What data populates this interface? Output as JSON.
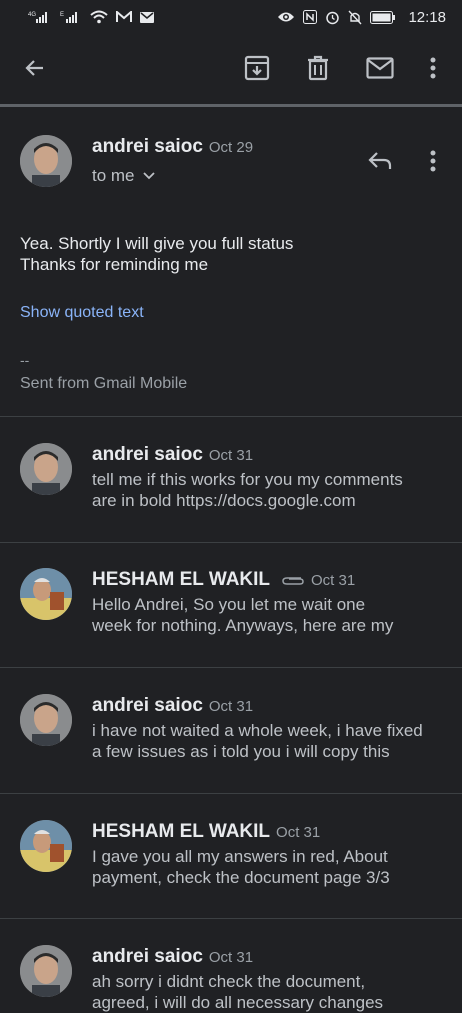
{
  "status_bar": {
    "network1": "4G",
    "network2": "E",
    "time": "12:18",
    "icons": [
      "signal-icon",
      "wifi-icon",
      "gmail-icon",
      "mail-icon",
      "eye-icon",
      "nfc-icon",
      "alarm-icon",
      "mute-icon",
      "battery-icon"
    ]
  },
  "toolbar": {
    "icons": [
      "back-arrow-icon",
      "archive-icon",
      "trash-icon",
      "mark-unread-icon",
      "more-vert-icon"
    ]
  },
  "open_message": {
    "sender": "andrei saioc",
    "date": "Oct 29",
    "recipient": "to me",
    "body_line1": "Yea. Shortly I will give you full status",
    "body_line2": "Thanks for reminding me",
    "quoted_link": "Show quoted text",
    "sig_dash": "--",
    "signature": "Sent from Gmail Mobile"
  },
  "messages": [
    {
      "sender": "andrei saioc",
      "date": "Oct 31",
      "line1": "tell me if this works for you my comments",
      "line2": "are in bold https://docs.google.com",
      "attachment": false
    },
    {
      "sender": "HESHAM EL WAKIL",
      "date": "Oct 31",
      "line1": "Hello Andrei, So you let me wait one",
      "line2": "week for nothing. Anyways, here are my",
      "attachment": true
    },
    {
      "sender": "andrei saioc",
      "date": "Oct 31",
      "line1": "i have not waited a whole week, i have fixed",
      "line2": "a few issues as i told you i will copy this",
      "attachment": false
    },
    {
      "sender": "HESHAM EL WAKIL",
      "date": "Oct 31",
      "line1": "I gave you all my answers in red, About",
      "line2": "payment, check the document page 3/3",
      "attachment": false
    },
    {
      "sender": "andrei saioc",
      "date": "Oct 31",
      "line1": "ah sorry i didnt check the document,",
      "line2": "agreed, i will do all necessary changes",
      "attachment": false
    }
  ],
  "colors": {
    "background": "#202124",
    "text": "#e8eaed",
    "secondary": "#9aa0a6",
    "link": "#8ab4f8"
  }
}
